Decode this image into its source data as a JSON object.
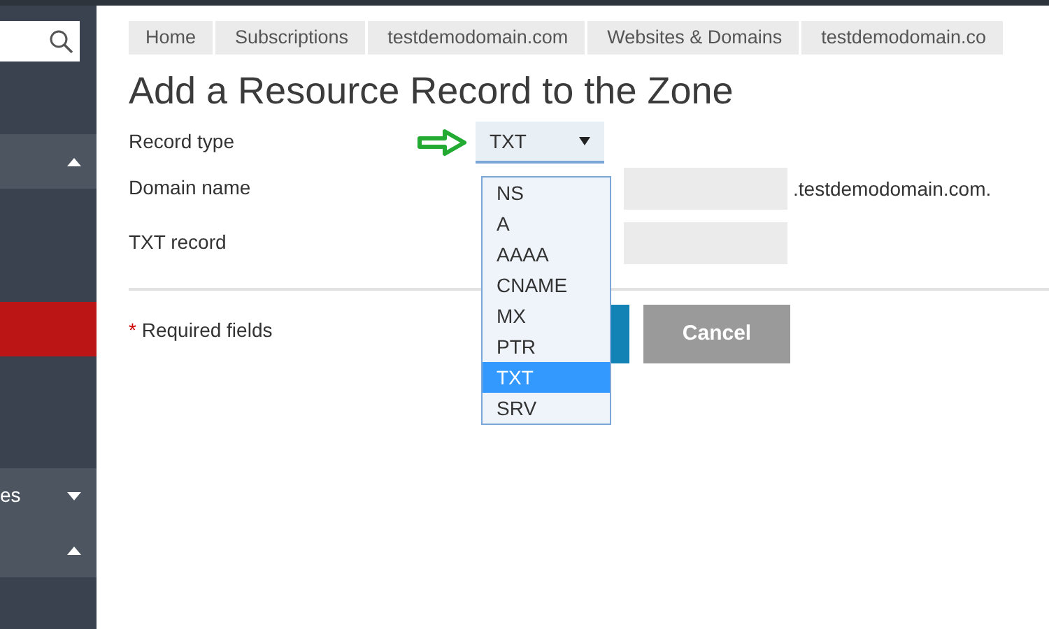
{
  "sidebar": {
    "sections": [
      {
        "kind": "group",
        "expanded": true
      },
      {
        "kind": "active"
      },
      {
        "kind": "group",
        "label": "es",
        "expanded": false
      },
      {
        "kind": "group",
        "expanded": true
      }
    ]
  },
  "breadcrumbs": [
    "Home",
    "Subscriptions",
    "testdemodomain.com",
    "Websites & Domains",
    "testdemodomain.co"
  ],
  "title": "Add a Resource Record to the Zone",
  "form": {
    "record_type": {
      "label": "Record type",
      "value": "TXT",
      "expanded": true,
      "options": [
        {
          "label": "NS",
          "selected": false
        },
        {
          "label": "A",
          "selected": false
        },
        {
          "label": "AAAA",
          "selected": false
        },
        {
          "label": "CNAME",
          "selected": false
        },
        {
          "label": "MX",
          "selected": false
        },
        {
          "label": "PTR",
          "selected": false
        },
        {
          "label": "TXT",
          "selected": true
        },
        {
          "label": "SRV",
          "selected": false
        }
      ]
    },
    "domain_name": {
      "label": "Domain name",
      "suffix": ".testdemodomain.com."
    },
    "txt_record": {
      "label": "TXT record"
    },
    "required_mark": "*",
    "required_note": "Required fields",
    "cancel": "Cancel"
  }
}
